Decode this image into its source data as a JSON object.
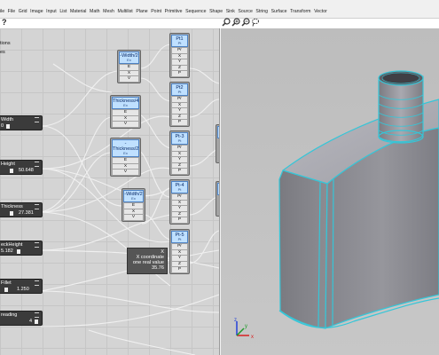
{
  "menu": {
    "items": [
      "ile",
      "File",
      "Grid",
      "Image",
      "Input",
      "List",
      "Material",
      "Math",
      "Mesh",
      "Multilist",
      "Plane",
      "Point",
      "Primitive",
      "Sequence",
      "Shape",
      "Sink",
      "Source",
      "String",
      "Surface",
      "Transform",
      "Vector"
    ]
  },
  "help": {
    "label": "?"
  },
  "toolbar": {
    "icons": [
      "zoom-icon",
      "zoom-in-icon",
      "zoom-out-icon",
      "lasso-icon"
    ]
  },
  "canvas": {
    "fragments": {
      "title": "tions",
      "subtitle": "es"
    },
    "sliders": [
      {
        "label": "Width",
        "value": "0"
      },
      {
        "label": "Height",
        "value": "50.648"
      },
      {
        "label": "Thickness",
        "value": "27.381"
      },
      {
        "label": "eckHeight",
        "value": "5.182"
      },
      {
        "label": "Fillet",
        "value": "1.250"
      },
      {
        "label": "reading",
        "value": "4"
      }
    ],
    "math_nodes": [
      {
        "title": "-Width/2",
        "subtitle": "Ex",
        "ports": [
          "E",
          "X",
          "V"
        ]
      },
      {
        "title": "Thickness/4",
        "subtitle": "Ex",
        "ports": [
          "E",
          "X",
          "V"
        ]
      },
      {
        "title": "-Thickness/2",
        "subtitle": "Ex",
        "ports": [
          "E",
          "X",
          "V"
        ]
      },
      {
        "title": "-Width/2",
        "subtitle": "Ex",
        "ports": [
          "E",
          "X",
          "V"
        ]
      }
    ],
    "point_nodes": [
      {
        "title": "Pt1",
        "subtitle": "Pt",
        "ports": [
          "Pr",
          "X",
          "Y",
          "Z",
          "P"
        ]
      },
      {
        "title": "Pt2",
        "subtitle": "Pt",
        "ports": [
          "Pr",
          "X",
          "Y",
          "Z",
          "P"
        ]
      },
      {
        "title": "Pt-3",
        "subtitle": "Pt",
        "ports": [
          "Pr",
          "X",
          "Y",
          "Z",
          "P"
        ]
      },
      {
        "title": "Pt-4",
        "subtitle": "Pt",
        "ports": [
          "Pr",
          "X",
          "Y",
          "Z",
          "P"
        ]
      },
      {
        "title": "Pt-5",
        "subtitle": "Pt",
        "ports": [
          "Pr",
          "X",
          "Y",
          "Z",
          "P"
        ]
      }
    ],
    "tooltip": {
      "line1": "X",
      "line2": "X coordinate",
      "line3": "one real value",
      "line4": "35.76"
    }
  },
  "viewport": {
    "axis_labels": {
      "x": "x",
      "y": "y",
      "z": "z"
    },
    "colors": {
      "x_axis": "#d62020",
      "y_axis": "#1f9a2a",
      "z_axis": "#2340d8",
      "edges": "#35c6d8",
      "body": "#8f8f95"
    }
  }
}
